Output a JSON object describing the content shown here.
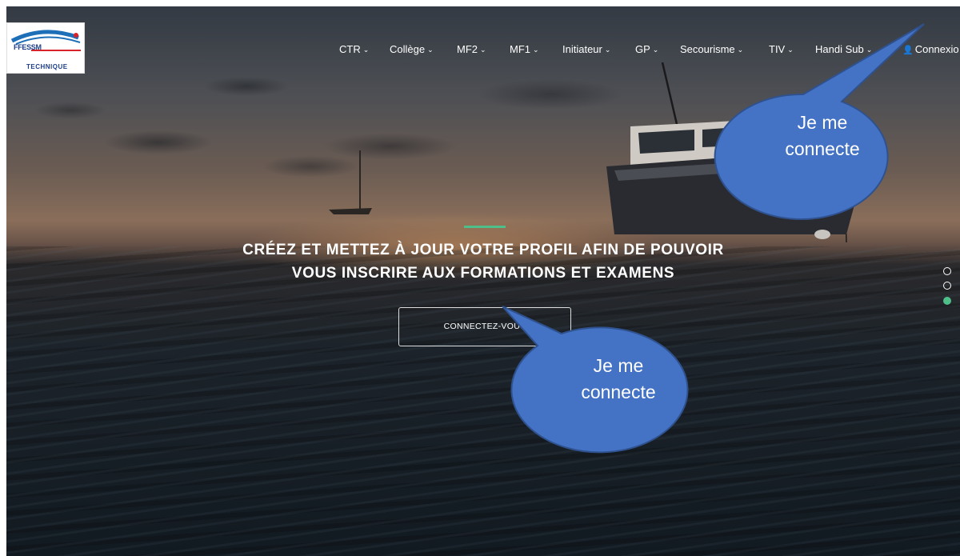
{
  "logo": {
    "name": "FFESSM",
    "subtitle": "TECHNIQUE"
  },
  "nav": {
    "items": [
      {
        "label": "CTR",
        "has_dropdown": true
      },
      {
        "label": "Collège",
        "has_dropdown": true
      },
      {
        "label": "MF2",
        "has_dropdown": true
      },
      {
        "label": "MF1",
        "has_dropdown": true
      },
      {
        "label": "Initiateur",
        "has_dropdown": true
      },
      {
        "label": "GP",
        "has_dropdown": true
      },
      {
        "label": "Secourisme",
        "has_dropdown": true
      },
      {
        "label": "TIV",
        "has_dropdown": true
      },
      {
        "label": "Handi Sub",
        "has_dropdown": true
      }
    ],
    "login": {
      "label": "Connexio",
      "icon": "user-icon"
    }
  },
  "hero": {
    "headline_line1": "CRÉEZ ET METTEZ À JOUR VOTRE PROFIL AFIN DE POUVOIR",
    "headline_line2": "VOUS INSCRIRE AUX FORMATIONS ET EXAMENS",
    "cta_label": "CONNECTEZ-VOUS",
    "accent_color": "#4fbf8a"
  },
  "slider": {
    "total": 3,
    "active_index": 2
  },
  "callouts": [
    {
      "line1": "Je me",
      "line2": "connecte",
      "fill": "#4472c4",
      "stroke": "#2f528f"
    },
    {
      "line1": "Je me",
      "line2": "connecte",
      "fill": "#4472c4",
      "stroke": "#2f528f"
    }
  ]
}
